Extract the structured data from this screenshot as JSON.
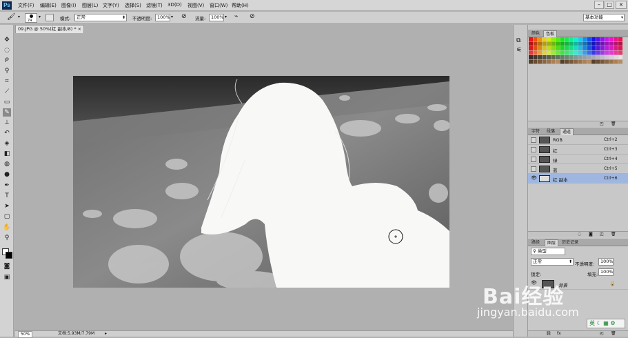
{
  "app": {
    "logo": "Ps"
  },
  "menu": [
    "文件(F)",
    "编辑(E)",
    "图像(I)",
    "图层(L)",
    "文字(Y)",
    "选择(S)",
    "滤镜(T)",
    "3D(D)",
    "视图(V)",
    "窗口(W)",
    "帮助(H)"
  ],
  "options": {
    "brush_size": "74",
    "mode_label": "模式:",
    "mode_value": "正常",
    "opacity_label": "不透明度:",
    "opacity_value": "100%",
    "flow_label": "流量:",
    "flow_value": "100%",
    "workspace": "基本功能"
  },
  "document": {
    "tab_title": "09.JPG @ 50%(红 副本/8) *",
    "close": "×",
    "zoom": "50%",
    "doc_info": "文档:5.93M/7.79M"
  },
  "swatch_panel": {
    "tabs": [
      "颜色",
      "色板"
    ]
  },
  "channels_panel": {
    "tabs": [
      "字符",
      "段落",
      "通道"
    ],
    "rows": [
      {
        "name": "RGB",
        "shortcut": "Ctrl+2"
      },
      {
        "name": "红",
        "shortcut": "Ctrl+3"
      },
      {
        "name": "绿",
        "shortcut": "Ctrl+4"
      },
      {
        "name": "蓝",
        "shortcut": "Ctrl+5"
      },
      {
        "name": "红 副本",
        "shortcut": "Ctrl+6"
      }
    ]
  },
  "layers_panel": {
    "tabs": [
      "路径",
      "图层",
      "历史记录"
    ],
    "kind_label": "类型",
    "blend": "正常",
    "opacity_label": "不透明度:",
    "opacity_value": "100%",
    "lock_label": "锁定:",
    "fill_label": "填充:",
    "fill_value": "100%",
    "layer_name": "背景"
  },
  "watermark": {
    "brand": "Bai经验",
    "url": "jingyan.baidu.com"
  },
  "ime": {
    "label": "英"
  },
  "colors": {
    "accent": "#9fb7e0",
    "panel": "#c8c8c8",
    "canvas_bg": "#b0b0b0"
  }
}
